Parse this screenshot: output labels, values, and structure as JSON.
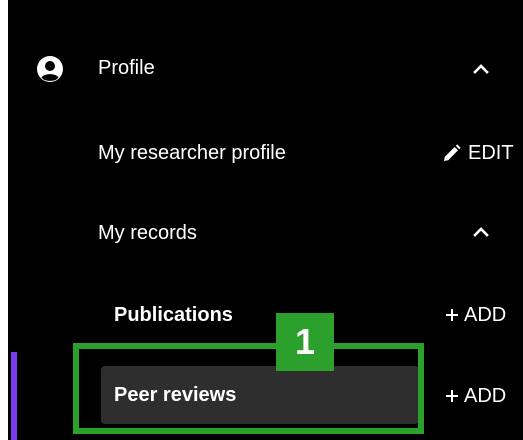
{
  "sidebar": {
    "profile": {
      "label": "Profile",
      "icon": "user-circle-icon",
      "toggle_icon": "chevron-up-icon"
    },
    "researcher_profile": {
      "label": "My researcher profile",
      "action_label": "EDIT",
      "action_icon": "pencil-icon"
    },
    "records": {
      "label": "My records",
      "toggle_icon": "chevron-up-icon",
      "items": [
        {
          "label": "Publications",
          "action_label": "ADD",
          "action_icon": "plus-icon"
        },
        {
          "label": "Peer reviews",
          "action_label": "ADD",
          "action_icon": "plus-icon",
          "active": true
        }
      ]
    }
  },
  "annotation": {
    "number": "1"
  },
  "colors": {
    "background": "#000000",
    "active_item": "#2e2e2e",
    "active_bar": "#7c3aed",
    "highlight": "#2ca02c"
  }
}
